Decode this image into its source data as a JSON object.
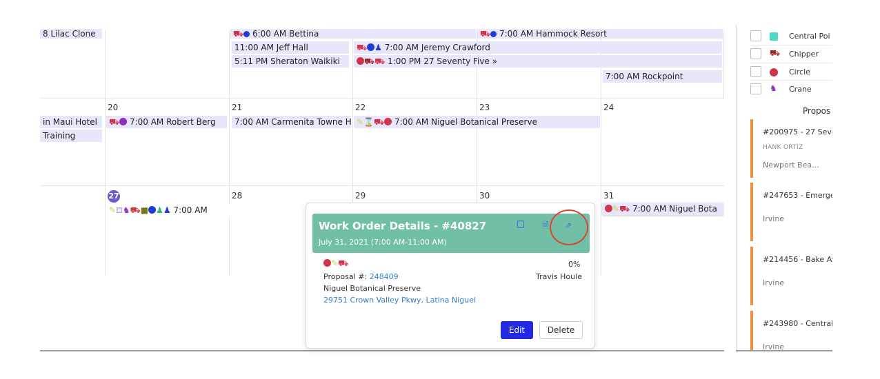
{
  "calendar": {
    "week1": {
      "events": [
        {
          "text": "8 Lilac Clone"
        },
        {
          "text": "6:00 AM Bettina"
        },
        {
          "text": "7:00 AM Hammock Resort"
        },
        {
          "text": "11:00 AM Jeff Hall"
        },
        {
          "text": "7:00 AM Jeremy Crawford"
        },
        {
          "text": "5:11 PM Sheraton Waikiki"
        },
        {
          "text": "1:00 PM 27 Seventy Five »"
        },
        {
          "text": "7:00 AM Rockpoint"
        }
      ]
    },
    "week2": {
      "days": [
        "20",
        "21",
        "22",
        "23",
        "24"
      ],
      "events": [
        {
          "text": "in Maui Hotel"
        },
        {
          "text": "Training"
        },
        {
          "text": "7:00 AM Robert Berg"
        },
        {
          "text": "7:00 AM Carmenita Towne H"
        },
        {
          "text": "7:00 AM Niguel Botanical Preserve"
        }
      ]
    },
    "week3": {
      "today": "27",
      "days": [
        "28",
        "29",
        "30",
        "31"
      ],
      "events": [
        {
          "text": "7:00 AM"
        },
        {
          "text": "7:00 AM Niguel Bota"
        }
      ]
    }
  },
  "popup": {
    "title": "Work Order Details - #40827",
    "date": "July 31, 2021  (7:00 AM-11:00 AM)",
    "percent": "0%",
    "proposal_label": "Proposal #: ",
    "proposal_number": "248409",
    "assignee": "Travis Houle",
    "site": "Niguel Botanical Preserve",
    "address": "29751 Crown Valley Pkwy, Latina Niguel",
    "edit_label": "Edit",
    "delete_label": "Delete",
    "icons": [
      "copy-icon",
      "pdf-icon",
      "external-link-icon"
    ]
  },
  "legend": [
    {
      "label": "Central Poi",
      "icon": "square-teal",
      "color": "#4fd6c4"
    },
    {
      "label": "Chipper",
      "icon": "chipper-icon",
      "color": "#9c2a2a"
    },
    {
      "label": "Circle",
      "icon": "circle-icon",
      "color": "#d1334a"
    },
    {
      "label": "Crane",
      "icon": "crane-icon",
      "color": "#8e2db3"
    }
  ],
  "proposals": {
    "title": "Propos",
    "cards": [
      {
        "id": "#200975 - 27 Seve",
        "person": "HANK ORTIZ",
        "city": "Newport Bea..."
      },
      {
        "id": "#247653 - Emerge",
        "city": "Irvine"
      },
      {
        "id": "#214456 - Bake Av",
        "city": "Irvine"
      },
      {
        "id": "#243980 - Central",
        "city": "Irvine"
      }
    ]
  },
  "colors": {
    "event_bg": "#e7e6fb",
    "popup_header": "#71bfa6",
    "edit_button": "#2229e0",
    "card_accent": "#ef9041",
    "highlight_circle": "#d9452e"
  }
}
